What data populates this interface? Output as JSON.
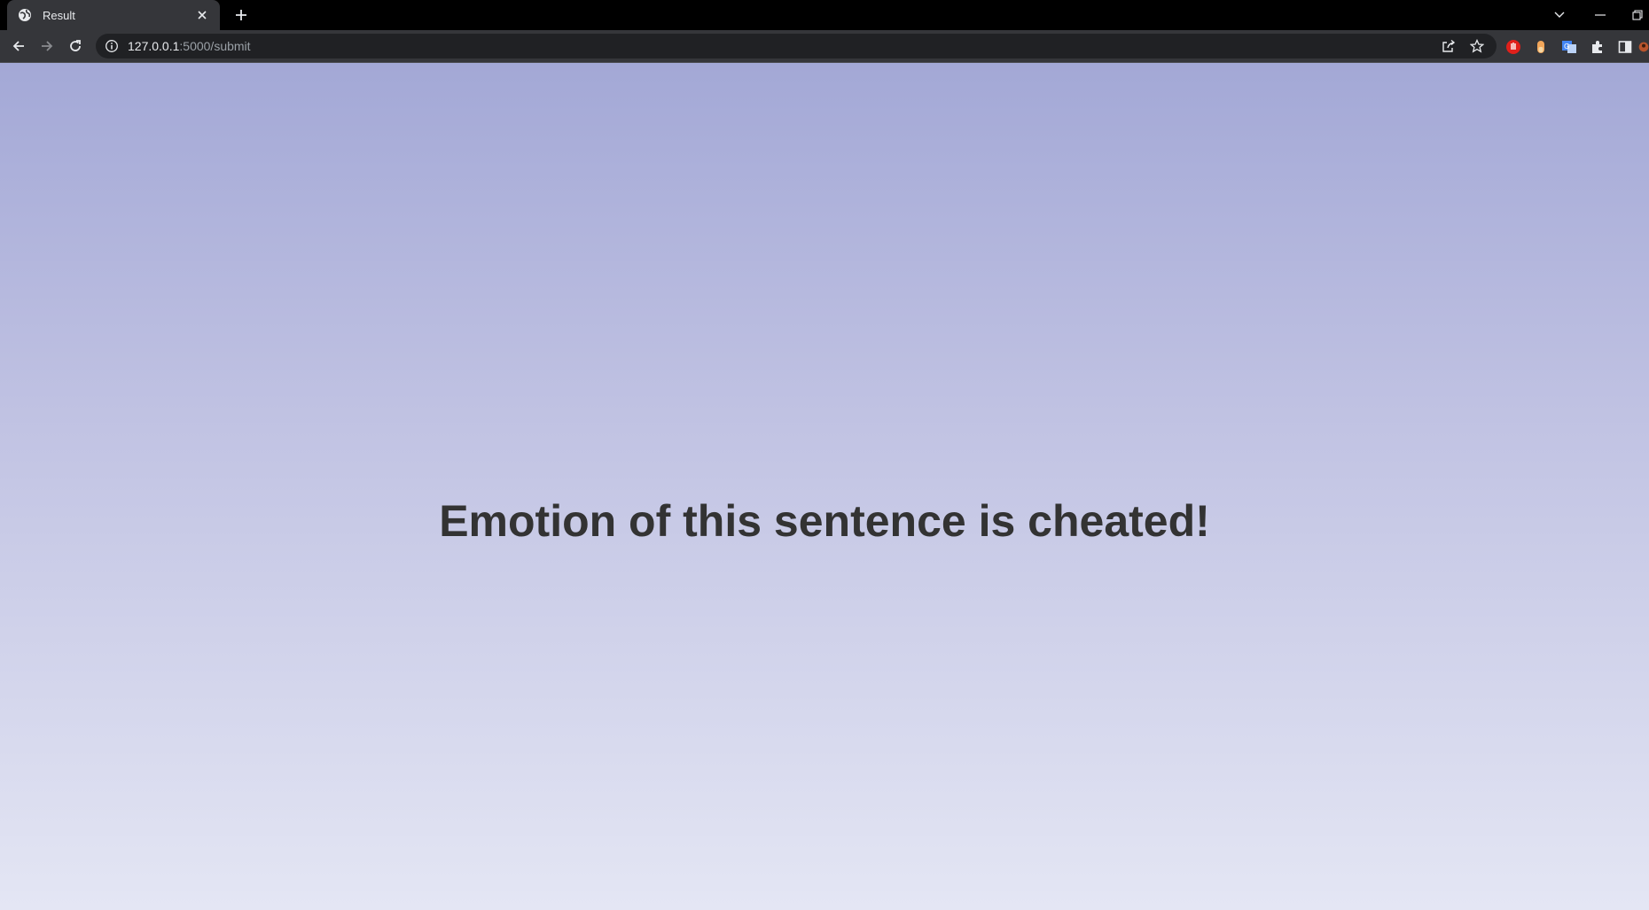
{
  "browser": {
    "tab": {
      "title": "Result"
    },
    "address_bar": {
      "host": "127.0.0.1",
      "path": ":5000/submit"
    }
  },
  "page": {
    "heading": "Emotion of this sentence is cheated!"
  },
  "colors": {
    "page_gradient_top": "#a3a8d6",
    "page_gradient_bottom": "#e4e6f4",
    "heading_text": "#333333",
    "browser_chrome": "#35363a"
  },
  "icons": {
    "tab_favicon": "globe-icon",
    "tab_close": "close-icon",
    "new_tab": "plus-icon",
    "back": "back-arrow-icon",
    "forward": "forward-arrow-icon",
    "reload": "reload-icon",
    "site_info": "info-icon",
    "share": "share-icon",
    "bookmark": "star-icon",
    "extensions": "puzzle-icon",
    "side_panel": "side-panel-icon"
  }
}
